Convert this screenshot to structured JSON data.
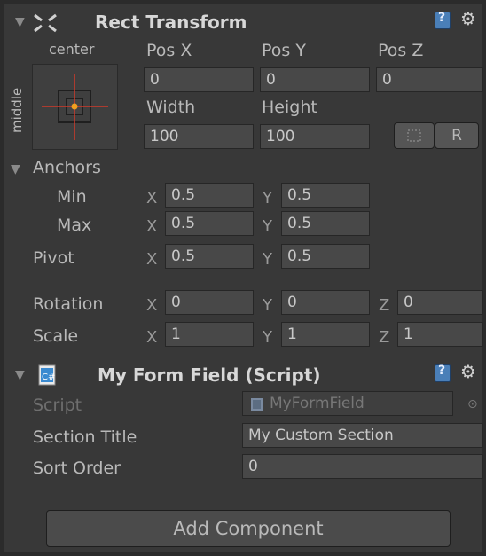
{
  "rect_transform": {
    "title": "Rect Transform",
    "anchor_preset_label": "center",
    "anchor_side_label": "middle",
    "col_headers": [
      "Pos X",
      "Pos Y",
      "Pos Z"
    ],
    "pos": [
      "0",
      "0",
      "0"
    ],
    "size_headers": [
      "Width",
      "Height"
    ],
    "size": [
      "100",
      "100"
    ],
    "r_button": "R",
    "anchors_label": "Anchors",
    "min_label": "Min",
    "max_label": "Max",
    "pivot_label": "Pivot",
    "rotation_label": "Rotation",
    "scale_label": "Scale",
    "axis_x": "X",
    "axis_y": "Y",
    "axis_z": "Z",
    "min": [
      "0.5",
      "0.5"
    ],
    "max": [
      "0.5",
      "0.5"
    ],
    "pivot": [
      "0.5",
      "0.5"
    ],
    "rotation": [
      "0",
      "0",
      "0"
    ],
    "scale": [
      "1",
      "1",
      "1"
    ]
  },
  "script_component": {
    "title": "My Form Field (Script)",
    "script_label": "Script",
    "script_value": "MyFormField",
    "section_title_label": "Section Title",
    "section_title_value": "My Custom Section",
    "sort_order_label": "Sort Order",
    "sort_order_value": "0"
  },
  "add_component": "Add Component",
  "colors": {
    "panel_bg": "#383838",
    "field_bg": "#484848",
    "anchor_red": "#d03a2a",
    "anchor_dot": "#f0a020",
    "help_icon": "#4a7fb8",
    "cs_icon": "#3a8ad0"
  }
}
